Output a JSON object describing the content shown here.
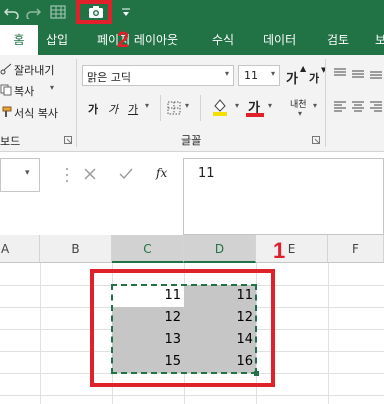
{
  "qat": {
    "title_icons": [
      "undo-icon",
      "redo-icon",
      "grid-icon",
      "camera-icon",
      "customize-icon"
    ]
  },
  "tabs": [
    "홈",
    "삽입",
    "페이지 레이아웃",
    "수식",
    "데이터",
    "검토",
    "보"
  ],
  "ribbon": {
    "clipboard": {
      "cut": "잘라내기",
      "copy": "복사",
      "format_painter": "서식 복사",
      "group_label": "보드"
    },
    "font": {
      "font_name": "맑은 고딕",
      "font_size": "11",
      "grow_font": "가",
      "shrink_font": "가",
      "bold": "가",
      "italic": "가",
      "underline": "가",
      "font_color": "가",
      "phonetic": "내천",
      "group_label": "글꼴"
    }
  },
  "formula_bar": {
    "name_box": "",
    "fx": "fx",
    "value": "11"
  },
  "sheet": {
    "columns": [
      "A",
      "B",
      "C",
      "D",
      "E",
      "F"
    ],
    "rows": [
      [
        "11",
        "11"
      ],
      [
        "12",
        "12"
      ],
      [
        "13",
        "14"
      ],
      [
        "15",
        "16"
      ]
    ]
  },
  "annotations": {
    "label_1": "1",
    "label_2": "2",
    "color": "#e0202a"
  },
  "colors": {
    "brand": "#217346",
    "selection": "#c6c6c6"
  }
}
